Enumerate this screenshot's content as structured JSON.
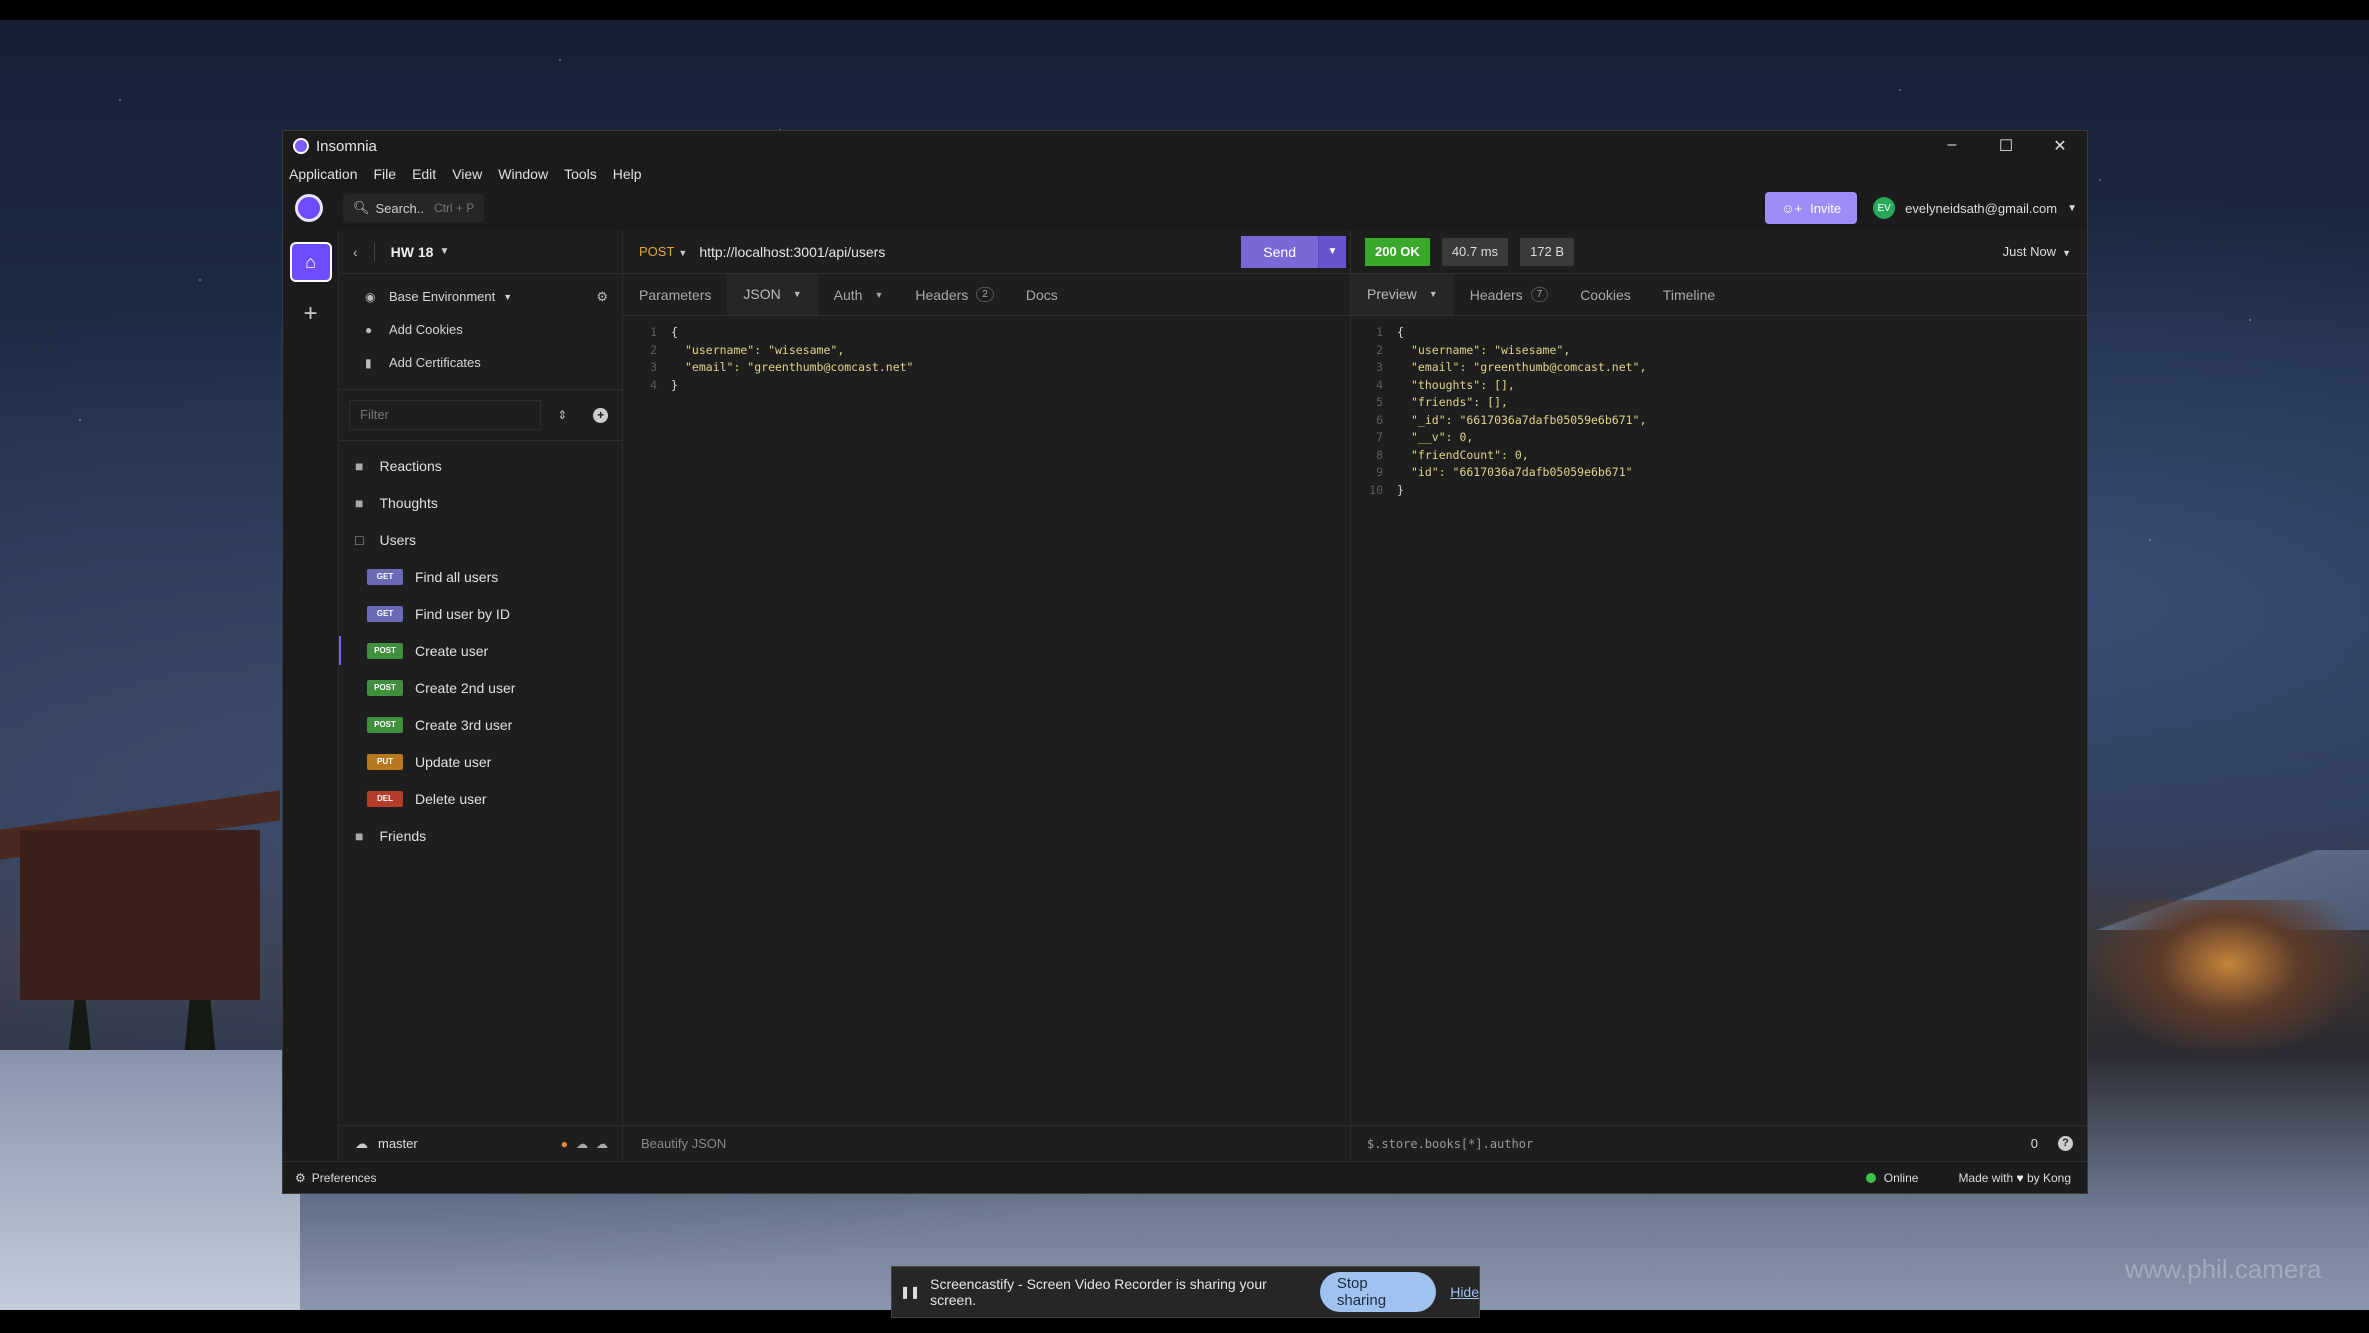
{
  "window": {
    "title": "Insomnia",
    "controls": [
      "–",
      "☐",
      "✕"
    ]
  },
  "menu": [
    "Application",
    "File",
    "Edit",
    "View",
    "Window",
    "Tools",
    "Help"
  ],
  "search": {
    "label": "Search..",
    "shortcut": "Ctrl + P"
  },
  "invite_label": "Invite",
  "user": {
    "initials": "EV",
    "email": "evelyneidsath@gmail.com"
  },
  "project": {
    "name": "HW 18"
  },
  "sidebar": {
    "environment": "Base Environment",
    "add_cookies": "Add Cookies",
    "add_certificates": "Add Certificates",
    "filter_placeholder": "Filter",
    "folders": {
      "reactions": "Reactions",
      "thoughts": "Thoughts",
      "users": "Users",
      "friends": "Friends"
    },
    "requests": [
      {
        "method": "GET",
        "name": "Find all users"
      },
      {
        "method": "GET",
        "name": "Find user by ID"
      },
      {
        "method": "POST",
        "name": "Create user"
      },
      {
        "method": "POST",
        "name": "Create 2nd user"
      },
      {
        "method": "POST",
        "name": "Create 3rd user"
      },
      {
        "method": "PUT",
        "name": "Update user"
      },
      {
        "method": "DEL",
        "name": "Delete user"
      }
    ],
    "branch": "master"
  },
  "request": {
    "method": "POST",
    "url": "http://localhost:3001/api/users",
    "send_label": "Send",
    "tabs": {
      "parameters": "Parameters",
      "body": "JSON",
      "auth": "Auth",
      "headers": "Headers",
      "headers_count": "2",
      "docs": "Docs"
    },
    "body_lines": [
      "{",
      "\"username\": \"wisesame\",",
      "\"email\": \"greenthumb@comcast.net\"",
      "}"
    ],
    "footer": "Beautify JSON"
  },
  "response": {
    "status": "200 OK",
    "time": "40.7 ms",
    "size": "172 B",
    "timestamp": "Just Now",
    "tabs": {
      "preview": "Preview",
      "headers": "Headers",
      "headers_count": "7",
      "cookies": "Cookies",
      "timeline": "Timeline"
    },
    "body_lines": [
      "{",
      "\"username\": \"wisesame\",",
      "\"email\": \"greenthumb@comcast.net\",",
      "\"thoughts\": [],",
      "\"friends\": [],",
      "\"_id\": \"6617036a7dafb05059e6b671\",",
      "\"__v\": 0,",
      "\"friendCount\": 0,",
      "\"id\": \"6617036a7dafb05059e6b671\"",
      "}"
    ],
    "filter_query": "$.store.books[*].author",
    "filter_count": "0"
  },
  "statusbar": {
    "preferences": "Preferences",
    "online": "Online",
    "made_with": "Made with",
    "by": "by Kong"
  },
  "screenshare": {
    "message": "Screencastify - Screen Video Recorder is sharing your screen.",
    "stop": "Stop sharing",
    "hide": "Hide"
  },
  "watermark": "www.phil.camera"
}
